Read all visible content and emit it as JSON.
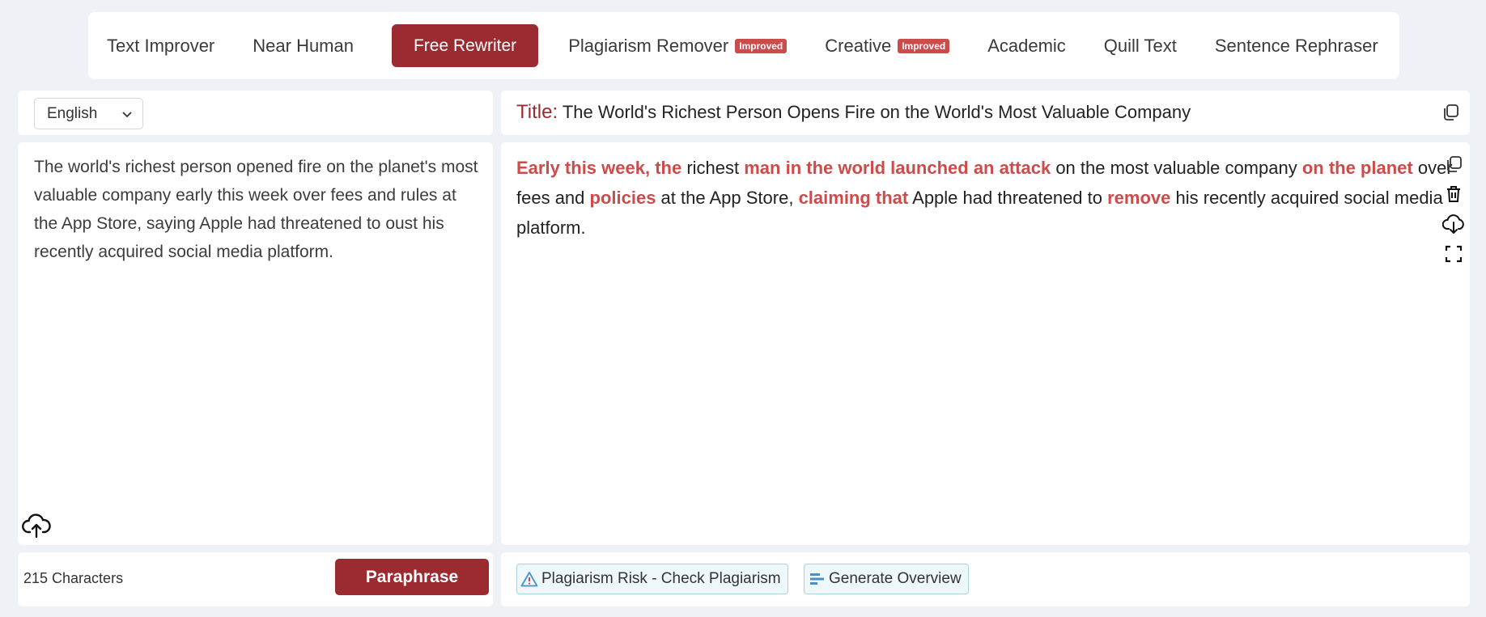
{
  "modes": [
    {
      "label": "Text Improver",
      "active": false,
      "badge": ""
    },
    {
      "label": "Near Human",
      "active": false,
      "badge": ""
    },
    {
      "label": "Free Rewriter",
      "active": true,
      "badge": ""
    },
    {
      "label": "Plagiarism Remover",
      "active": false,
      "badge": "Improved"
    },
    {
      "label": "Creative",
      "active": false,
      "badge": "Improved"
    },
    {
      "label": "Academic",
      "active": false,
      "badge": ""
    },
    {
      "label": "Quill Text",
      "active": false,
      "badge": ""
    },
    {
      "label": "Sentence Rephraser",
      "active": false,
      "badge": ""
    }
  ],
  "language": {
    "selected": "English"
  },
  "input": {
    "text": "The world's richest person opened fire on the planet's most valuable company early this week over fees and rules at the App Store, saying Apple had threatened to oust his recently acquired social media platform.",
    "char_count": "215 Characters"
  },
  "buttons": {
    "paraphrase": "Paraphrase"
  },
  "output": {
    "title_label": "Title:",
    "title": "The World's Richest Person Opens Fire on the World's Most Valuable Company",
    "segments": [
      {
        "text": "Early this week, the",
        "changed": true
      },
      {
        "text": " richest ",
        "changed": false
      },
      {
        "text": "man in the world launched an attack",
        "changed": true
      },
      {
        "text": " on the most valuable company ",
        "changed": false
      },
      {
        "text": "on the planet",
        "changed": true
      },
      {
        "text": " over fees and ",
        "changed": false
      },
      {
        "text": "policies",
        "changed": true
      },
      {
        "text": " at the App Store, ",
        "changed": false
      },
      {
        "text": "claiming that",
        "changed": true
      },
      {
        "text": " Apple had threatened to ",
        "changed": false
      },
      {
        "text": "remove",
        "changed": true
      },
      {
        "text": " his recently acquired social media platform.",
        "changed": false
      }
    ]
  },
  "actions": {
    "plagiarism_check": "Plagiarism Risk - Check Plagiarism",
    "generate_overview": "Generate Overview"
  },
  "icons": {
    "copy": "copy-icon",
    "trash": "trash-icon",
    "download": "cloud-download-icon",
    "fullscreen": "fullscreen-icon",
    "upload": "cloud-upload-icon",
    "warning": "warning-icon",
    "overview": "bars-icon"
  },
  "colors": {
    "accent": "#9b2b30",
    "highlight": "#cc4b4b",
    "badge": "#cc4b4b",
    "chip_border": "#a7d3df",
    "page_bg": "#eef2f6"
  }
}
